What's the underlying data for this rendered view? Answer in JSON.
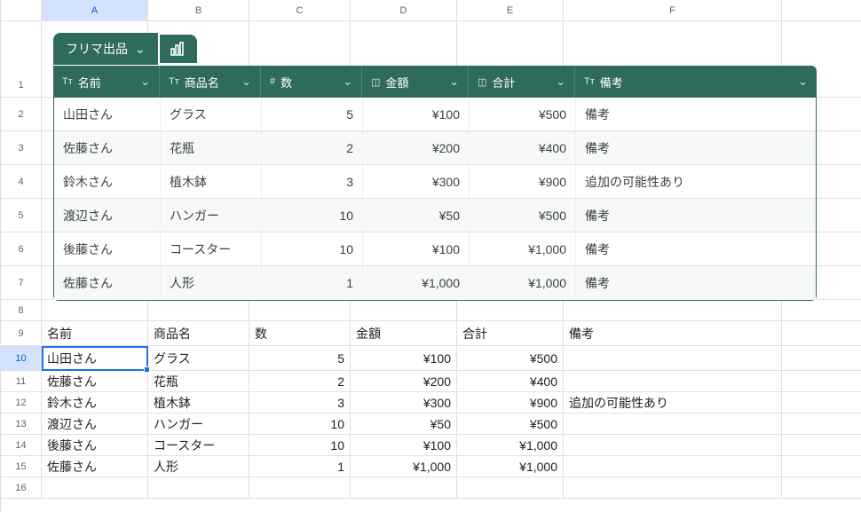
{
  "columns": [
    "A",
    "B",
    "C",
    "D",
    "E",
    "F"
  ],
  "selected_column": "A",
  "selected_row": 10,
  "tab": {
    "name": "フリマ出品"
  },
  "smart_headers": [
    {
      "icon": "Tᴛ",
      "label": "名前"
    },
    {
      "icon": "Tᴛ",
      "label": "商品名"
    },
    {
      "icon": "#",
      "label": "数"
    },
    {
      "icon": "◫",
      "label": "金額"
    },
    {
      "icon": "◫",
      "label": "合計"
    },
    {
      "icon": "Tᴛ",
      "label": "備考"
    }
  ],
  "smart_rows": [
    {
      "name": "山田さん",
      "item": "グラス",
      "qty": "5",
      "amount": "¥100",
      "total": "¥500",
      "note": "備考"
    },
    {
      "name": "佐藤さん",
      "item": "花瓶",
      "qty": "2",
      "amount": "¥200",
      "total": "¥400",
      "note": "備考"
    },
    {
      "name": "鈴木さん",
      "item": "植木鉢",
      "qty": "3",
      "amount": "¥300",
      "total": "¥900",
      "note": "追加の可能性あり"
    },
    {
      "name": "渡辺さん",
      "item": "ハンガー",
      "qty": "10",
      "amount": "¥50",
      "total": "¥500",
      "note": "備考"
    },
    {
      "name": "後藤さん",
      "item": "コースター",
      "qty": "10",
      "amount": "¥100",
      "total": "¥1,000",
      "note": "備考"
    },
    {
      "name": "佐藤さん",
      "item": "人形",
      "qty": "1",
      "amount": "¥1,000",
      "total": "¥1,000",
      "note": "備考"
    }
  ],
  "plain_header": {
    "a": "名前",
    "b": "商品名",
    "c": "数",
    "d": "金額",
    "e": "合計",
    "f": "備考"
  },
  "plain_rows": [
    {
      "a": "山田さん",
      "b": "グラス",
      "c": "5",
      "d": "¥100",
      "e": "¥500",
      "f": ""
    },
    {
      "a": "佐藤さん",
      "b": "花瓶",
      "c": "2",
      "d": "¥200",
      "e": "¥400",
      "f": ""
    },
    {
      "a": "鈴木さん",
      "b": "植木鉢",
      "c": "3",
      "d": "¥300",
      "e": "¥900",
      "f": "追加の可能性あり"
    },
    {
      "a": "渡辺さん",
      "b": "ハンガー",
      "c": "10",
      "d": "¥50",
      "e": "¥500",
      "f": ""
    },
    {
      "a": "後藤さん",
      "b": "コースター",
      "c": "10",
      "d": "¥100",
      "e": "¥1,000",
      "f": ""
    },
    {
      "a": "佐藤さん",
      "b": "人形",
      "c": "1",
      "d": "¥1,000",
      "e": "¥1,000",
      "f": ""
    }
  ],
  "row_labels": [
    "1",
    "2",
    "3",
    "4",
    "5",
    "6",
    "7",
    "8",
    "9",
    "10",
    "11",
    "12",
    "13",
    "14",
    "15",
    "16"
  ],
  "chevron": "⌄",
  "selected_cell_value": "山田さん"
}
